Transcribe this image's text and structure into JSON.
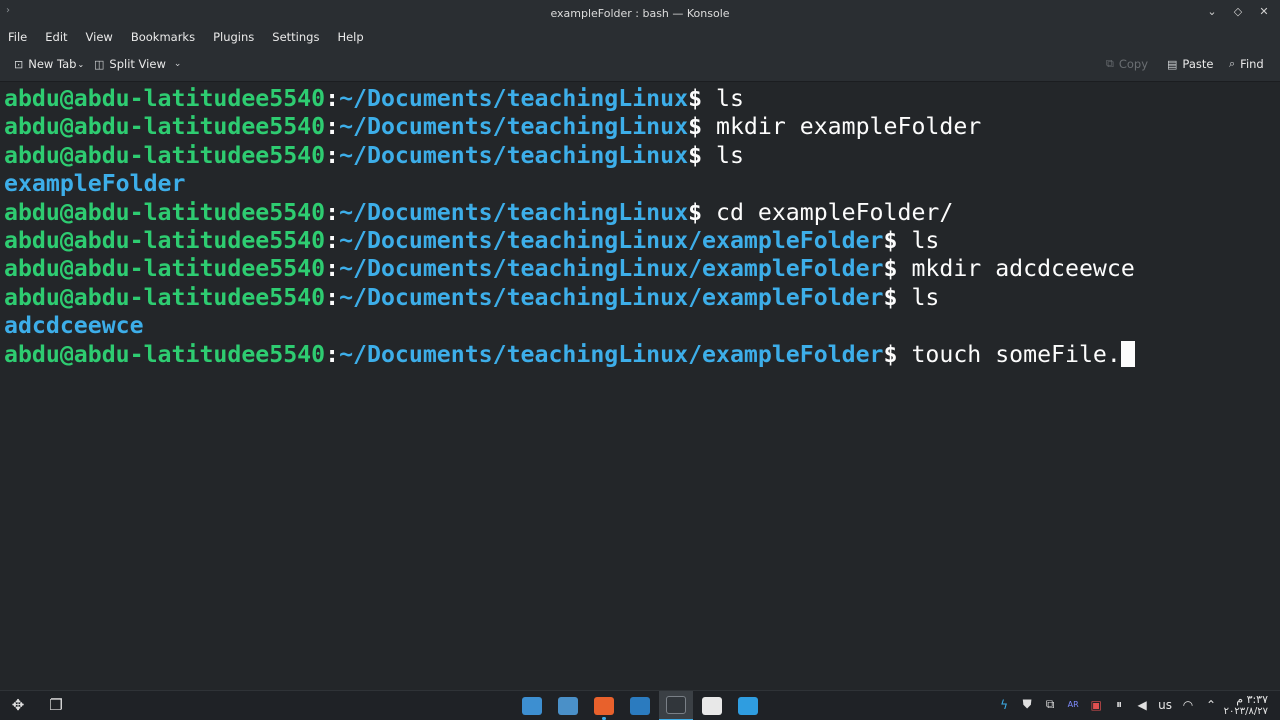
{
  "window": {
    "title": "exampleFolder : bash — Konsole",
    "buttons": [
      "minimize",
      "maximize",
      "close"
    ]
  },
  "menubar": {
    "items": [
      "File",
      "Edit",
      "View",
      "Bookmarks",
      "Plugins",
      "Settings",
      "Help"
    ]
  },
  "toolbar": {
    "new_tab": "New Tab",
    "split_view": "Split View",
    "copy": "Copy",
    "paste": "Paste",
    "find": "Find"
  },
  "terminal": {
    "prompt_user": "abdu@abdu-latitudee5540",
    "lines": [
      {
        "type": "prompt",
        "path": "~/Documents/teachingLinux",
        "cmd": "ls"
      },
      {
        "type": "prompt",
        "path": "~/Documents/teachingLinux",
        "cmd": "mkdir exampleFolder"
      },
      {
        "type": "prompt",
        "path": "~/Documents/teachingLinux",
        "cmd": "ls"
      },
      {
        "type": "output",
        "text": "exampleFolder"
      },
      {
        "type": "prompt",
        "path": "~/Documents/teachingLinux",
        "cmd": "cd exampleFolder/"
      },
      {
        "type": "prompt",
        "path": "~/Documents/teachingLinux/exampleFolder",
        "cmd": "ls"
      },
      {
        "type": "prompt",
        "path": "~/Documents/teachingLinux/exampleFolder",
        "cmd": "mkdir adcdceewce"
      },
      {
        "type": "prompt",
        "path": "~/Documents/teachingLinux/exampleFolder",
        "cmd": "ls"
      },
      {
        "type": "output",
        "text": "adcdceewce"
      },
      {
        "type": "prompt",
        "path": "~/Documents/teachingLinux/exampleFolder",
        "cmd": "touch someFile."
      }
    ]
  },
  "taskbar": {
    "tasks": [
      {
        "name": "file-manager-task",
        "color": "#3d8fd1"
      },
      {
        "name": "software-center-task",
        "color": "#4a90c8"
      },
      {
        "name": "firefox-task",
        "color": "#e8612c"
      },
      {
        "name": "vscode-task",
        "color": "#2b7bbf"
      },
      {
        "name": "konsole-task",
        "color": "#31363b"
      },
      {
        "name": "vim-task",
        "color": "#e8e8e8"
      },
      {
        "name": "text-editor-task",
        "color": "#2f9de0"
      }
    ],
    "keyboard_layout": "us",
    "time": "٣:٣٧ م",
    "date": "٢٠٢٣/٨/٢٧"
  },
  "colors": {
    "background": "#232629",
    "user": "#2ecc71",
    "path": "#3daee9",
    "text": "#fcfcfc",
    "chrome": "#2a2e32"
  }
}
